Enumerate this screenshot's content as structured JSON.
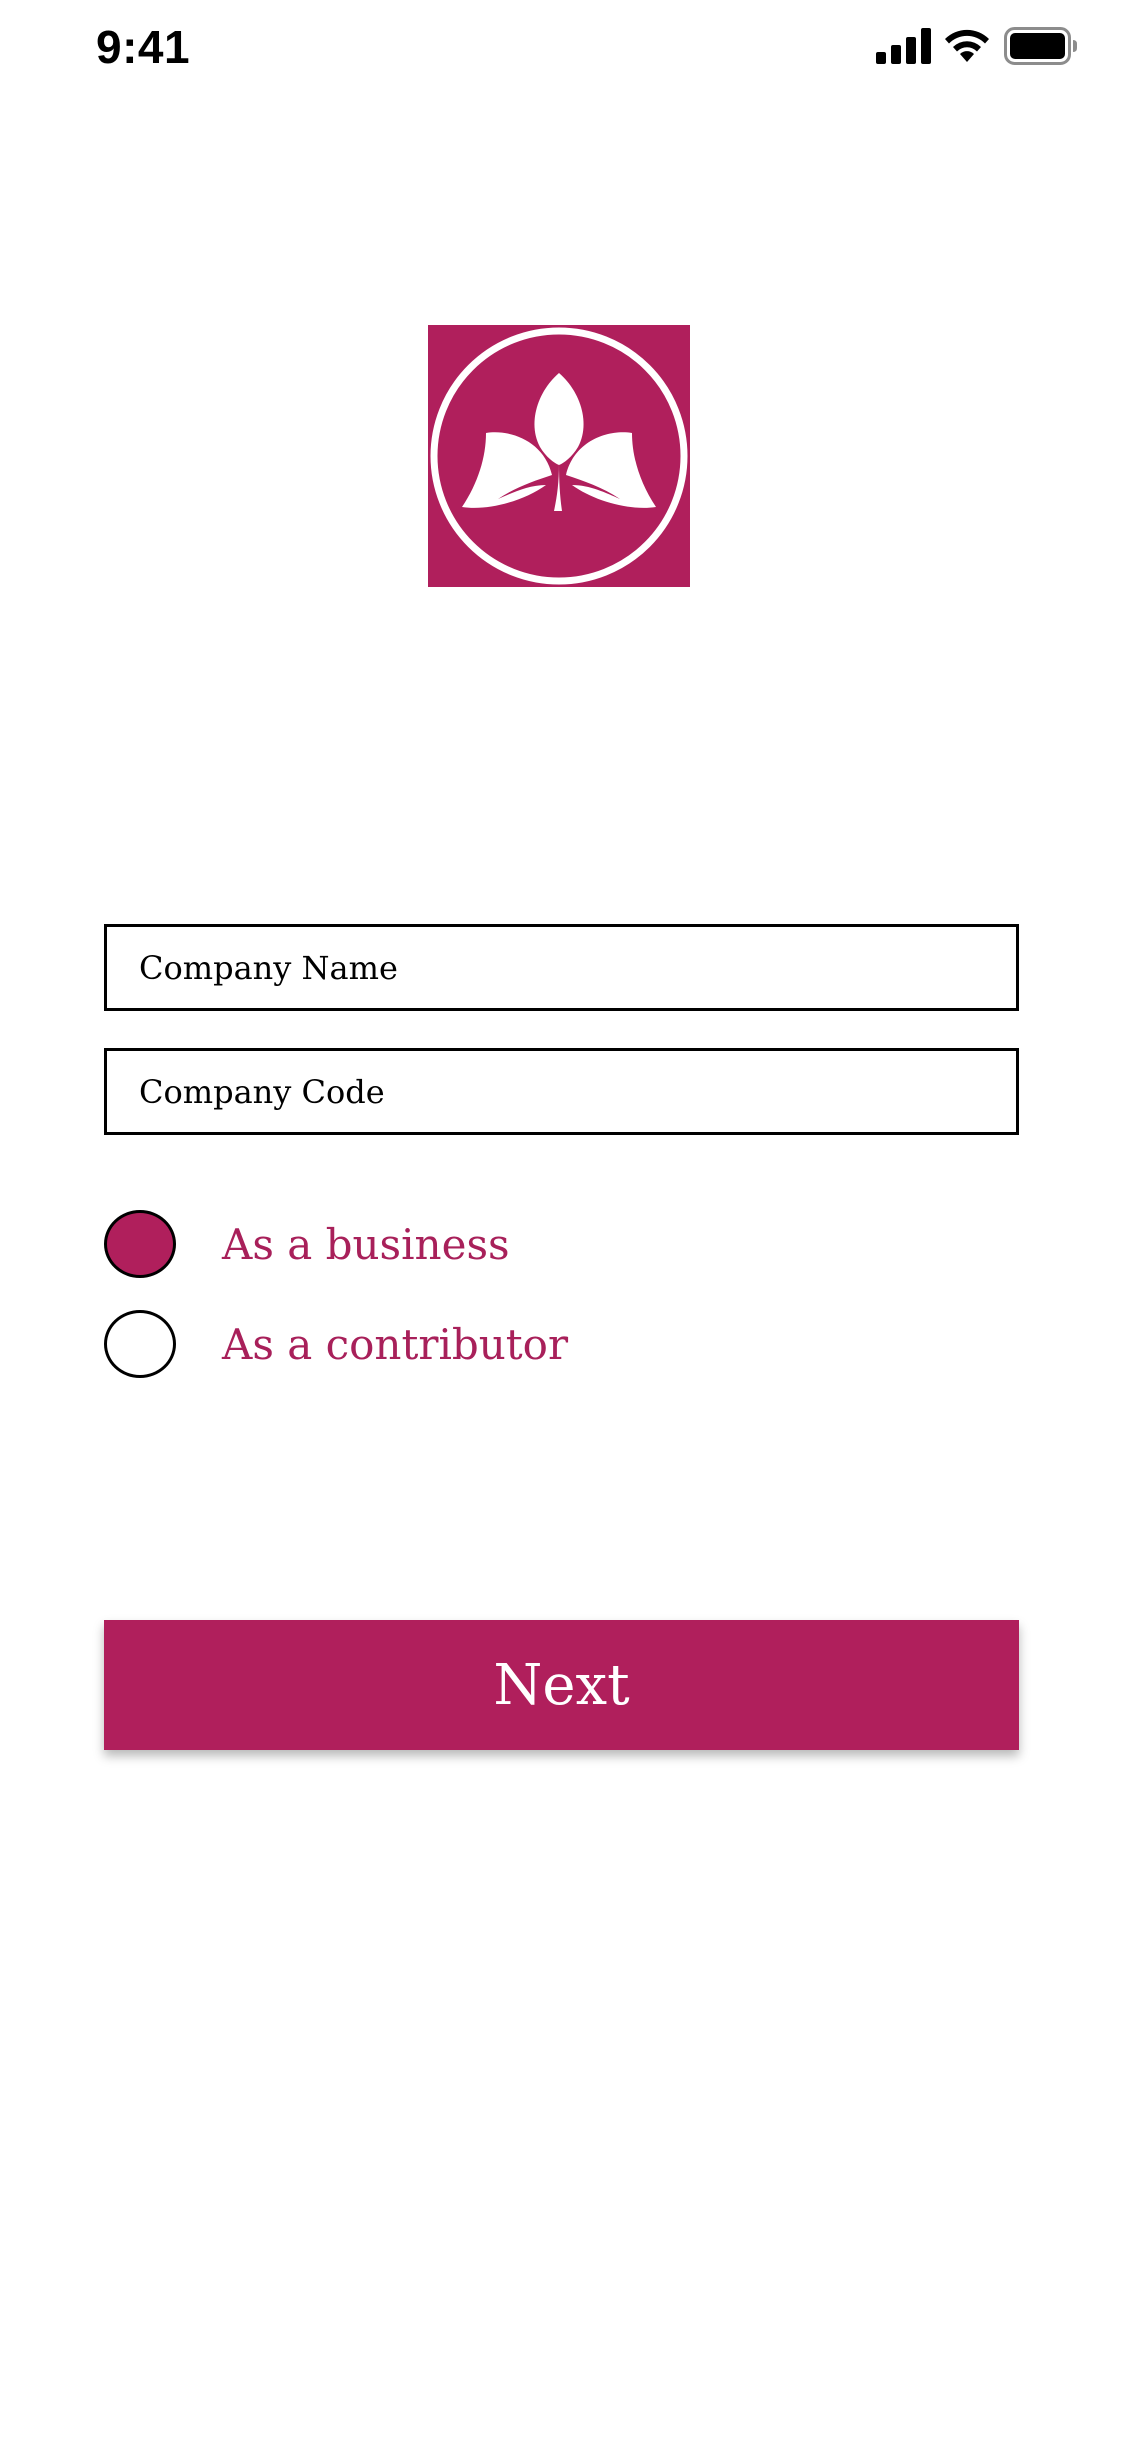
{
  "status_bar": {
    "time": "9:41",
    "icons": [
      "signal-icon",
      "wifi-icon",
      "battery-icon"
    ]
  },
  "logo": {
    "icon": "leaf-logo-icon",
    "background_color": "#b01f5c"
  },
  "form": {
    "company_name": {
      "placeholder": "Company Name",
      "value": ""
    },
    "company_code": {
      "placeholder": "Company Code",
      "value": ""
    },
    "role_options": [
      {
        "label": "As a business",
        "selected": true
      },
      {
        "label": "As a contributor",
        "selected": false
      }
    ],
    "next_label": "Next"
  },
  "colors": {
    "accent": "#b01f5c",
    "label_text": "#a8205a"
  }
}
